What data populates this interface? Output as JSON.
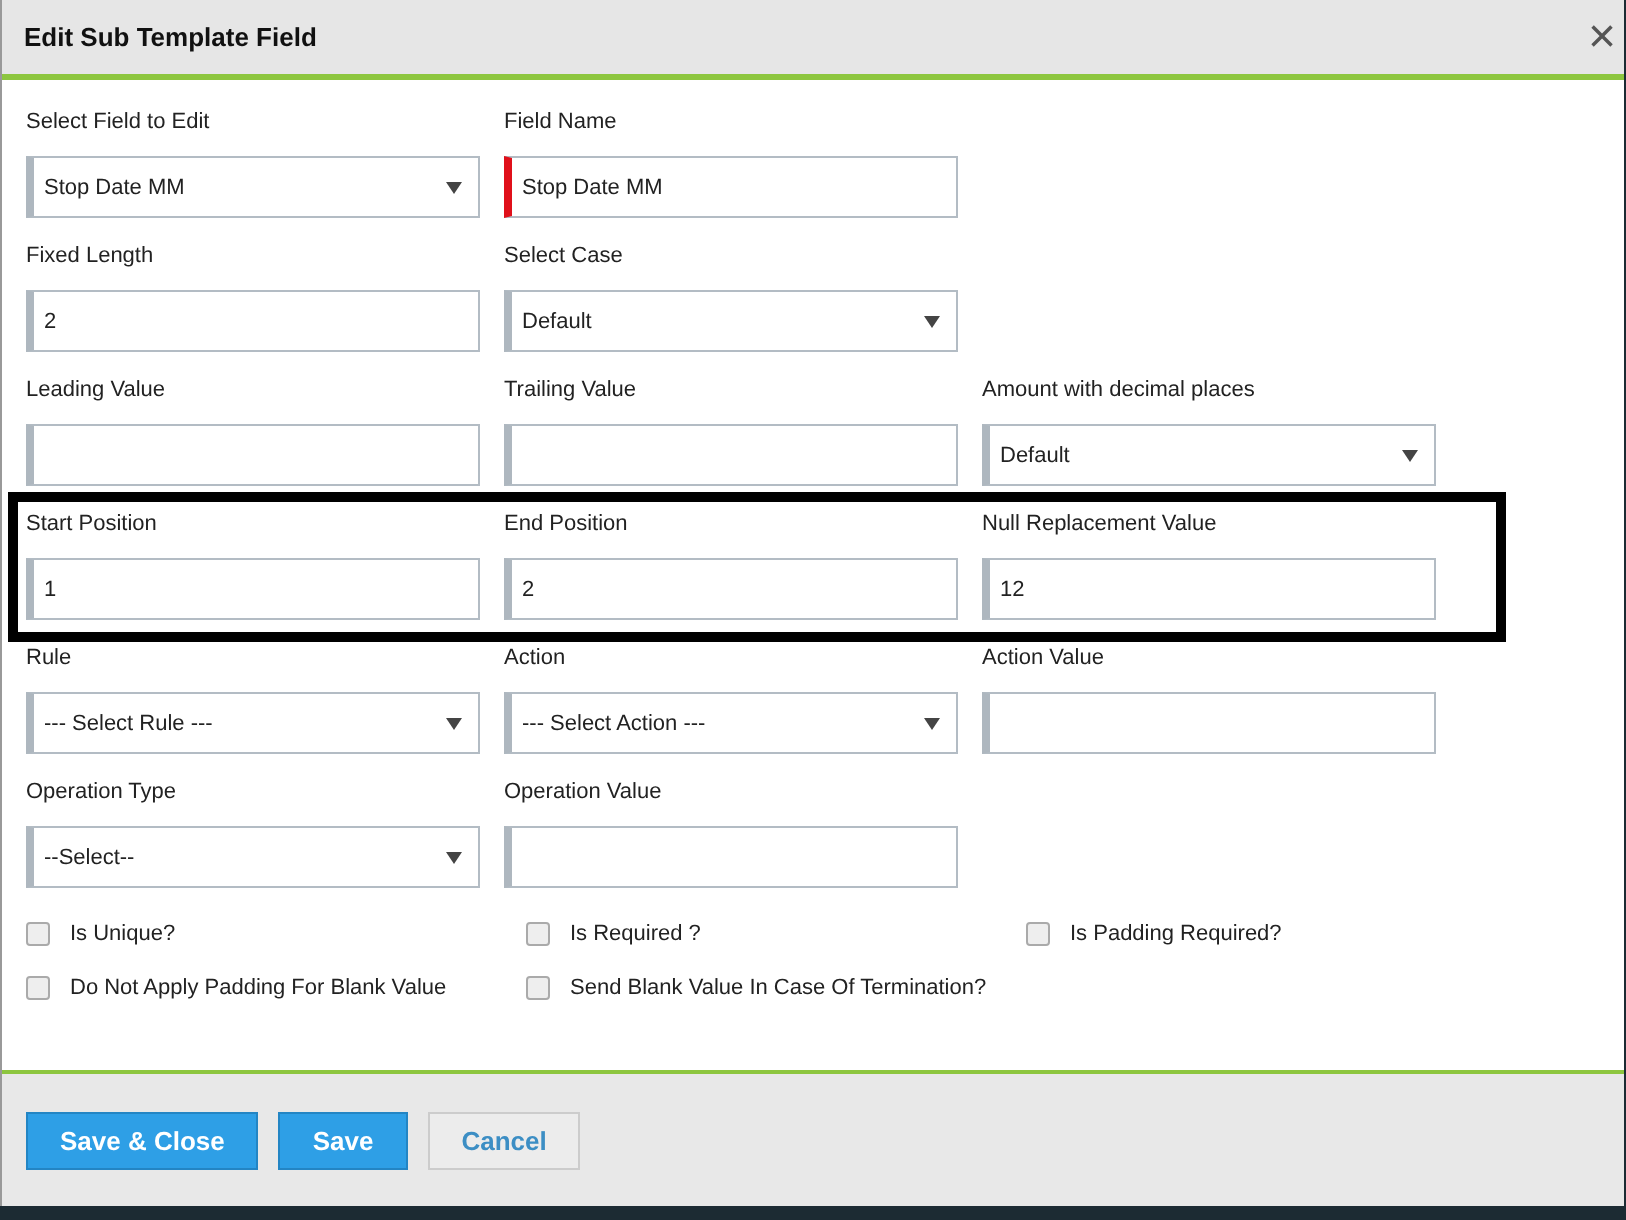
{
  "dialog": {
    "title": "Edit Sub Template Field",
    "close": "×"
  },
  "rows": [
    {
      "highlighted": false,
      "fields": [
        {
          "label": "Select Field to Edit",
          "kind": "select",
          "value": "Stop Date MM",
          "required": false
        },
        {
          "label": "Field Name",
          "kind": "text",
          "value": "Stop Date MM",
          "required": true
        }
      ]
    },
    {
      "highlighted": false,
      "fields": [
        {
          "label": "Fixed Length",
          "kind": "text",
          "value": "2",
          "required": false
        },
        {
          "label": "Select Case",
          "kind": "select",
          "value": "Default",
          "required": false
        }
      ]
    },
    {
      "highlighted": false,
      "fields": [
        {
          "label": "Leading Value",
          "kind": "text",
          "required": false
        },
        {
          "label": "Trailing Value",
          "kind": "text",
          "required": false
        },
        {
          "label": "Amount with decimal places",
          "kind": "select",
          "value": "Default",
          "required": false
        }
      ]
    },
    {
      "highlighted": true,
      "fields": [
        {
          "label": "Start Position",
          "kind": "text",
          "value": "1",
          "required": false
        },
        {
          "label": "End Position",
          "kind": "text",
          "value": "2",
          "required": false
        },
        {
          "label": "Null Replacement Value",
          "kind": "text",
          "value": "12",
          "required": false
        }
      ]
    },
    {
      "highlighted": false,
      "fields": [
        {
          "label": "Rule",
          "kind": "select",
          "value": "--- Select Rule ---",
          "required": false
        },
        {
          "label": "Action",
          "kind": "select",
          "value": "--- Select Action ---",
          "required": false
        },
        {
          "label": "Action Value",
          "kind": "text",
          "required": false
        }
      ]
    },
    {
      "highlighted": false,
      "fields": [
        {
          "label": "Operation Type",
          "kind": "select",
          "value": "--Select--",
          "required": false
        },
        {
          "label": "Operation Value",
          "kind": "text",
          "required": false
        }
      ]
    }
  ],
  "checkbox_rows": [
    [
      {
        "label": "Is Unique?",
        "checked": false
      },
      {
        "label": "Is Required ?",
        "checked": false
      },
      {
        "label": "Is Padding Required?",
        "checked": false
      }
    ],
    [
      {
        "label": "Do Not Apply Padding For Blank Value",
        "checked": false
      },
      {
        "label": "Send Blank Value In Case Of Termination?",
        "checked": false
      }
    ]
  ],
  "buttons": [
    {
      "label": "Save & Close",
      "kind": "primary"
    },
    {
      "label": "Save",
      "kind": "primary"
    },
    {
      "label": "Cancel",
      "kind": "secondary"
    }
  ]
}
